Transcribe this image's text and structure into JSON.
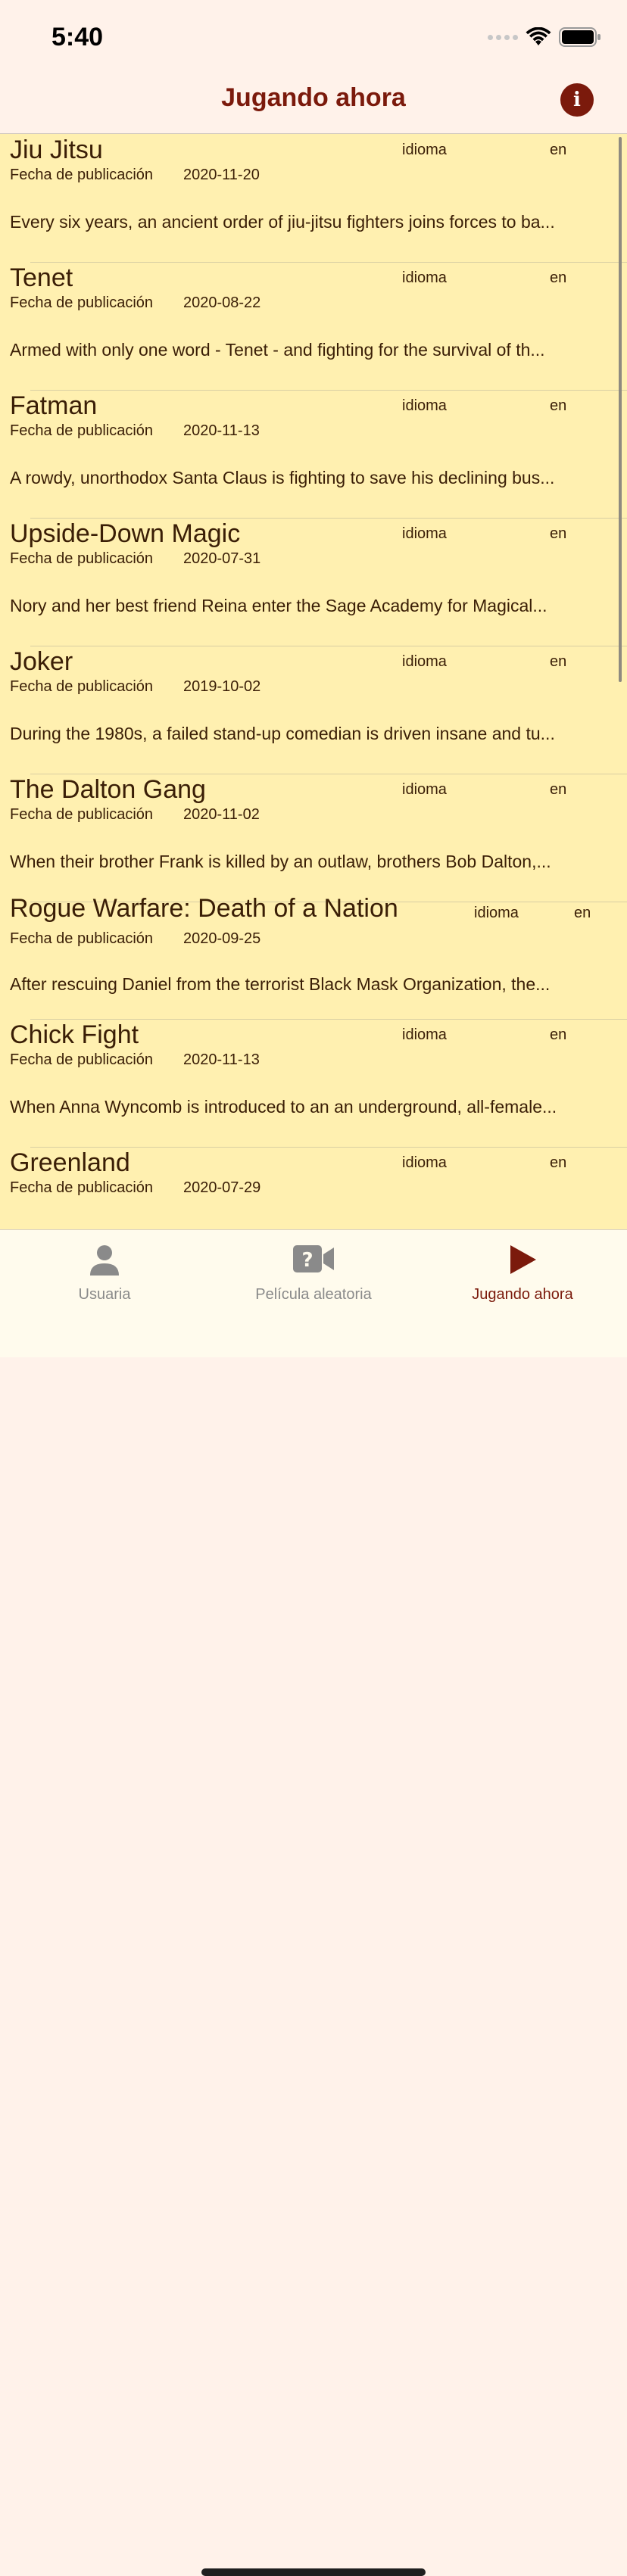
{
  "status_bar": {
    "time": "5:40"
  },
  "nav": {
    "title": "Jugando ahora"
  },
  "labels": {
    "language": "idioma",
    "release_date": "Fecha de publicación"
  },
  "movies": [
    {
      "title": "Jiu Jitsu",
      "language": "en",
      "release_date": "2020-11-20",
      "overview": "Every six years, an ancient order of jiu-jitsu fighters joins forces to ba..."
    },
    {
      "title": "Tenet",
      "language": "en",
      "release_date": "2020-08-22",
      "overview": "Armed with only one word - Tenet - and fighting for the survival of th..."
    },
    {
      "title": "Fatman",
      "language": "en",
      "release_date": "2020-11-13",
      "overview": "A rowdy, unorthodox Santa Claus is fighting to save his declining bus..."
    },
    {
      "title": "Upside-Down Magic",
      "language": "en",
      "release_date": "2020-07-31",
      "overview": "Nory and her best friend Reina enter the Sage Academy for Magical..."
    },
    {
      "title": "Joker",
      "language": "en",
      "release_date": "2019-10-02",
      "overview": "During the 1980s, a failed stand-up comedian is driven insane and tu..."
    },
    {
      "title": "The Dalton Gang",
      "language": "en",
      "release_date": "2020-11-02",
      "overview": "When their brother Frank is killed by an outlaw, brothers Bob Dalton,..."
    },
    {
      "title": "Rogue Warfare: Death of a Nation",
      "language": "en",
      "release_date": "2020-09-25",
      "overview": "After rescuing Daniel from the terrorist Black Mask Organization, the..."
    },
    {
      "title": "Chick Fight",
      "language": "en",
      "release_date": "2020-11-13",
      "overview": "When Anna Wyncomb is introduced to an an underground, all-female..."
    },
    {
      "title": "Greenland",
      "language": "en",
      "release_date": "2020-07-29",
      "overview": ""
    }
  ],
  "tabs": [
    {
      "label": "Usuaria",
      "icon": "person-icon"
    },
    {
      "label": "Película aleatoria",
      "icon": "question-video-icon"
    },
    {
      "label": "Jugando ahora",
      "icon": "play-icon"
    }
  ],
  "colors": {
    "accent": "#7b1a0c",
    "list_background": "#fff0b0",
    "header_background": "#fff2ea",
    "inactive_tab": "#8a8a8a"
  }
}
